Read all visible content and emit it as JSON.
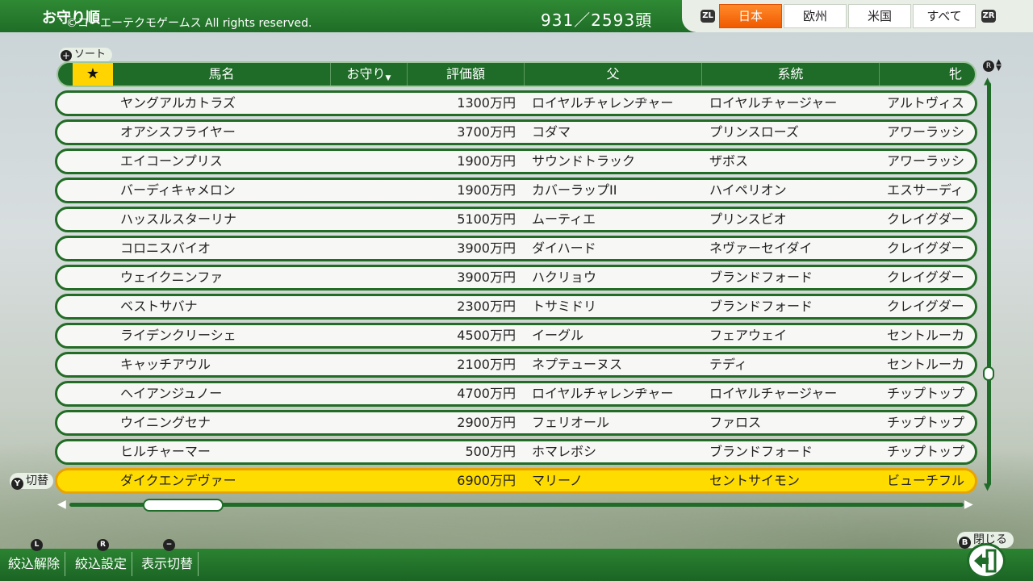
{
  "header": {
    "title": "お守り順",
    "copyright": "©コーエーテクモゲームス All rights reserved.",
    "count": "931／2593頭",
    "left_trigger": "ZL",
    "right_trigger": "ZR",
    "tabs": [
      {
        "label": "日本",
        "active": true
      },
      {
        "label": "欧州",
        "active": false
      },
      {
        "label": "米国",
        "active": false
      },
      {
        "label": "すべて",
        "active": false
      }
    ]
  },
  "sort_label": "ソート",
  "table": {
    "columns": {
      "star": "★",
      "name": "馬名",
      "omamori": "お守り",
      "value": "評価額",
      "sire": "父",
      "line": "系統",
      "dam_line": "牝"
    },
    "rows": [
      {
        "name": "ヤングアルカトラズ",
        "value": "1300万円",
        "sire": "ロイヤルチャレンヂャー",
        "line": "ロイヤルチャージャー",
        "dam": "アルトヴィス"
      },
      {
        "name": "オアシスフライヤー",
        "value": "3700万円",
        "sire": "コダマ",
        "line": "プリンスローズ",
        "dam": "アワーラッシ"
      },
      {
        "name": "エイコーンプリス",
        "value": "1900万円",
        "sire": "サウンドトラック",
        "line": "ザボス",
        "dam": "アワーラッシ"
      },
      {
        "name": "バーディキャメロン",
        "value": "1900万円",
        "sire": "カバーラップII",
        "line": "ハイペリオン",
        "dam": "エスサーディ"
      },
      {
        "name": "ハッスルスターリナ",
        "value": "5100万円",
        "sire": "ムーティエ",
        "line": "プリンスビオ",
        "dam": "クレイグダー"
      },
      {
        "name": "コロニスバイオ",
        "value": "3900万円",
        "sire": "ダイハード",
        "line": "ネヴァーセイダイ",
        "dam": "クレイグダー"
      },
      {
        "name": "ウェイクニンファ",
        "value": "3900万円",
        "sire": "ハクリョウ",
        "line": "ブランドフォード",
        "dam": "クレイグダー"
      },
      {
        "name": "ベストサバナ",
        "value": "2300万円",
        "sire": "トサミドリ",
        "line": "ブランドフォード",
        "dam": "クレイグダー"
      },
      {
        "name": "ライデンクリーシェ",
        "value": "4500万円",
        "sire": "イーグル",
        "line": "フェアウェイ",
        "dam": "セントルーカ"
      },
      {
        "name": "キャッチアウル",
        "value": "2100万円",
        "sire": "ネプテューヌス",
        "line": "テディ",
        "dam": "セントルーカ"
      },
      {
        "name": "ヘイアンジュノー",
        "value": "4700万円",
        "sire": "ロイヤルチャレンヂャー",
        "line": "ロイヤルチャージャー",
        "dam": "チップトップ"
      },
      {
        "name": "ウイニングセナ",
        "value": "2900万円",
        "sire": "フェリオール",
        "line": "ファロス",
        "dam": "チップトップ"
      },
      {
        "name": "ヒルチャーマー",
        "value": "500万円",
        "sire": "ホマレボシ",
        "line": "ブランドフォード",
        "dam": "チップトップ"
      },
      {
        "name": "ダイクエンデヴァー",
        "value": "6900万円",
        "sire": "マリーノ",
        "line": "セントサイモン",
        "dam": "ビューチフル",
        "selected": true
      }
    ]
  },
  "swap_label": "切替",
  "swap_button": "Y",
  "r_button": "R",
  "footer": {
    "buttons": [
      {
        "badge": "L",
        "label": "絞込解除"
      },
      {
        "badge": "R",
        "label": "絞込設定"
      },
      {
        "badge": "−",
        "label": "表示切替"
      }
    ],
    "close_button": "B",
    "close_label": "閉じる"
  },
  "colors": {
    "accent_green": "#1f6b28",
    "selected_row": "#ffdc00",
    "active_tab": "#f05a00",
    "star_cell": "#ffd400"
  },
  "scroll": {
    "vertical_position": 0.73,
    "horizontal_position": 0.09
  }
}
